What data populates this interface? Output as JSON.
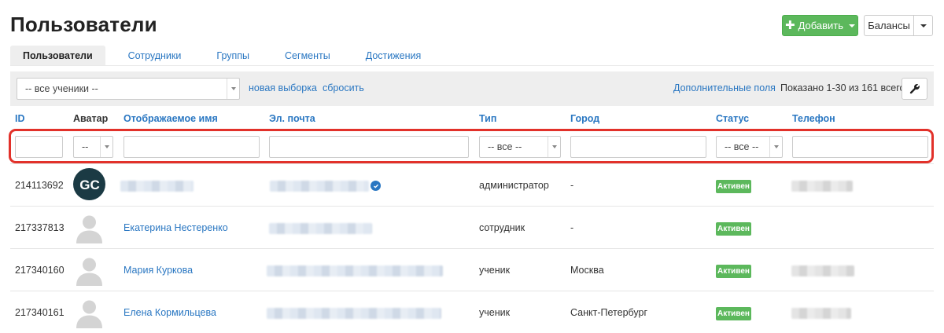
{
  "page": {
    "title": "Пользователи"
  },
  "toolbar": {
    "add_label": "Добавить",
    "balance_label": "Балансы"
  },
  "tabs": [
    {
      "label": "Пользователи",
      "active": true
    },
    {
      "label": "Сотрудники",
      "active": false
    },
    {
      "label": "Группы",
      "active": false
    },
    {
      "label": "Сегменты",
      "active": false
    },
    {
      "label": "Достижения",
      "active": false
    }
  ],
  "filterbar": {
    "segment_value": "-- все ученики --",
    "new_selection": "новая выборка",
    "reset": "сбросить",
    "extra_fields": "Дополнительные поля",
    "shown_text": "Показано 1-30 из 161 всего."
  },
  "columns": {
    "id": "ID",
    "avatar": "Аватар",
    "name": "Отображаемое имя",
    "email": "Эл. почта",
    "type": "Тип",
    "city": "Город",
    "status": "Статус",
    "phone": "Телефон"
  },
  "filters": {
    "avatar_value": "--",
    "type_value": "-- все --",
    "status_value": "-- все --"
  },
  "rows": [
    {
      "id": "214113692",
      "name": "",
      "type": "администратор",
      "city": "-",
      "status": "Активен"
    },
    {
      "id": "217337813",
      "name": "Екатерина Нестеренко",
      "type": "сотрудник",
      "city": "-",
      "status": "Активен"
    },
    {
      "id": "217340160",
      "name": "Мария Куркова",
      "type": "ученик",
      "city": "Москва",
      "status": "Активен"
    },
    {
      "id": "217340161",
      "name": "Елена Кормильцева",
      "type": "ученик",
      "city": "Санкт-Петербург",
      "status": "Активен"
    }
  ],
  "avatar_logo_text": "GC",
  "colors": {
    "accent": "#2a77c2",
    "success": "#5cb85c",
    "highlight": "#e2312a",
    "logo_bg": "#1b3a44"
  }
}
